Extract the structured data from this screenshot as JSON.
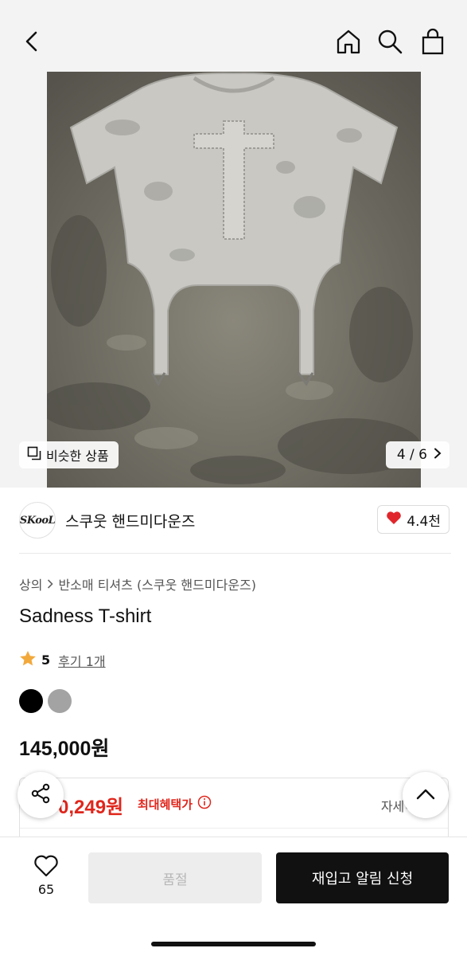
{
  "similar_button": {
    "label": "비슷한 상품",
    "icon": "similar-items-icon"
  },
  "pager": {
    "text": "4 / 6"
  },
  "shop": {
    "logo_text": "SKooL",
    "name": "스쿠웃 핸드미다운즈",
    "like_count": "4.4천"
  },
  "breadcrumb": {
    "category": "상의",
    "subcategory": "반소매 티셔츠 (스쿠웃 핸드미다운즈)"
  },
  "product": {
    "title": "Sadness T-shirt",
    "rating": "5",
    "review_label": "후기 1개",
    "price": "145,000원",
    "colors": [
      "#000000",
      "#a3a3a3"
    ]
  },
  "benefit": {
    "price": "0,249원",
    "label": "최대혜택가",
    "detail": "자세히"
  },
  "bottom": {
    "wish_count": "65",
    "soldout_label": "품절",
    "restock_label": "재입고 알림 신청"
  },
  "colors": {
    "accent_red": "#e0261c",
    "primary_black": "#111111",
    "heart_red": "#e0262c"
  }
}
